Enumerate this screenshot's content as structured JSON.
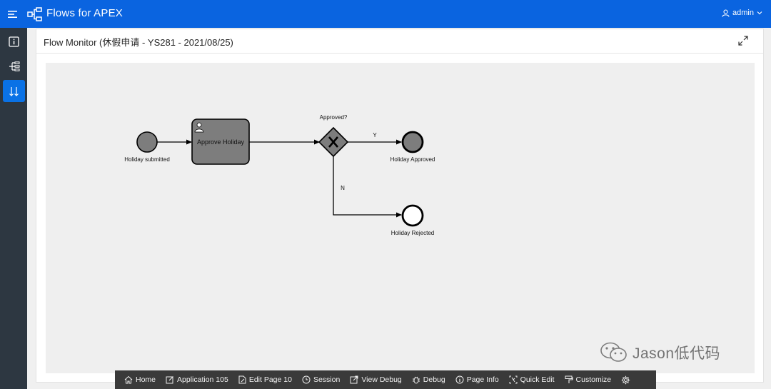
{
  "app": {
    "title": "Flows for APEX",
    "user": "admin"
  },
  "sidebar": {
    "items": [
      {
        "icon": "info-square-icon"
      },
      {
        "icon": "sitemap-icon"
      },
      {
        "icon": "sort-arrows-icon"
      }
    ]
  },
  "region": {
    "title": "Flow Monitor (休假申请 - YS281 - 2021/08/25)"
  },
  "diagram": {
    "start_label": "Holiday submitted",
    "task_label": "Approve Holiday",
    "gateway_label": "Approved?",
    "flow_yes_label": "Y",
    "flow_no_label": "N",
    "end_approved_label": "Holiday Approved",
    "end_rejected_label": "Holiday Rejected",
    "colors": {
      "completed_fill": "#7d7d7d",
      "stroke": "#000000",
      "canvas": "#efefef"
    }
  },
  "devbar": {
    "items": [
      {
        "label": "Home",
        "icon": "home-icon"
      },
      {
        "label": "Application 105",
        "icon": "edit-icon"
      },
      {
        "label": "Edit Page 10",
        "icon": "file-edit-icon"
      },
      {
        "label": "Session",
        "icon": "clock-icon"
      },
      {
        "label": "View Debug",
        "icon": "external-icon"
      },
      {
        "label": "Debug",
        "icon": "bug-icon"
      },
      {
        "label": "Page Info",
        "icon": "info-circle-icon"
      },
      {
        "label": "Quick Edit",
        "icon": "quick-edit-icon"
      },
      {
        "label": "Customize",
        "icon": "paint-roller-icon"
      },
      {
        "label": "",
        "icon": "gear-icon"
      }
    ]
  },
  "watermark": {
    "text": "Jason低代码"
  }
}
